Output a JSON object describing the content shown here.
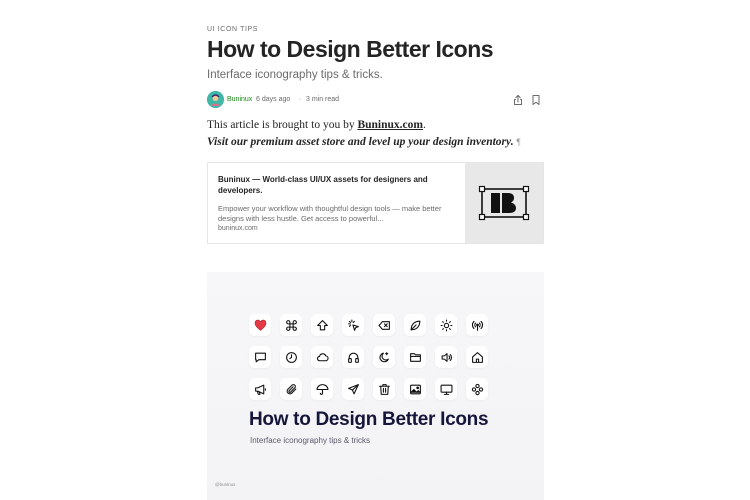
{
  "article": {
    "kicker": "UI ICON TIPS",
    "title": "How to Design Better Icons",
    "subtitle": "Interface iconography tips & tricks.",
    "author": "Buninux",
    "date": "6 days ago",
    "separator": "·",
    "read_time": "3 min read",
    "body_prefix": "This article is brought to you by ",
    "body_link": "Buninux.com",
    "body_suffix": ".",
    "body_line2": "Visit our premium asset store and level up your design inventory.",
    "pilcrow": "¶"
  },
  "embed": {
    "title": "Buninux — World-class UI/UX assets for designers and developers.",
    "description": "Empower your workflow with thoughtful design tools — make better designs with less hustle. Get access to powerful...",
    "domain": "buninux.com"
  },
  "hero": {
    "title": "How to Design Better Icons",
    "subtitle": "Interface iconography tips & tricks",
    "credit": "@buninux",
    "icons": [
      "heart-icon",
      "command-icon",
      "arrow-up-icon",
      "cursor-click-icon",
      "backspace-icon",
      "leaf-icon",
      "sun-icon",
      "broadcast-icon",
      "chat-icon",
      "clock-icon",
      "cloud-icon",
      "headphones-icon",
      "moon-icon",
      "folder-icon",
      "speaker-icon",
      "home-icon",
      "megaphone-icon",
      "paperclip-icon",
      "umbrella-icon",
      "send-icon",
      "trash-icon",
      "image-icon",
      "monitor-icon",
      "gamepad-icon"
    ]
  },
  "colors": {
    "heart": "#e53945",
    "hero_title": "#15163a",
    "avatar": "#3fb8a8"
  }
}
